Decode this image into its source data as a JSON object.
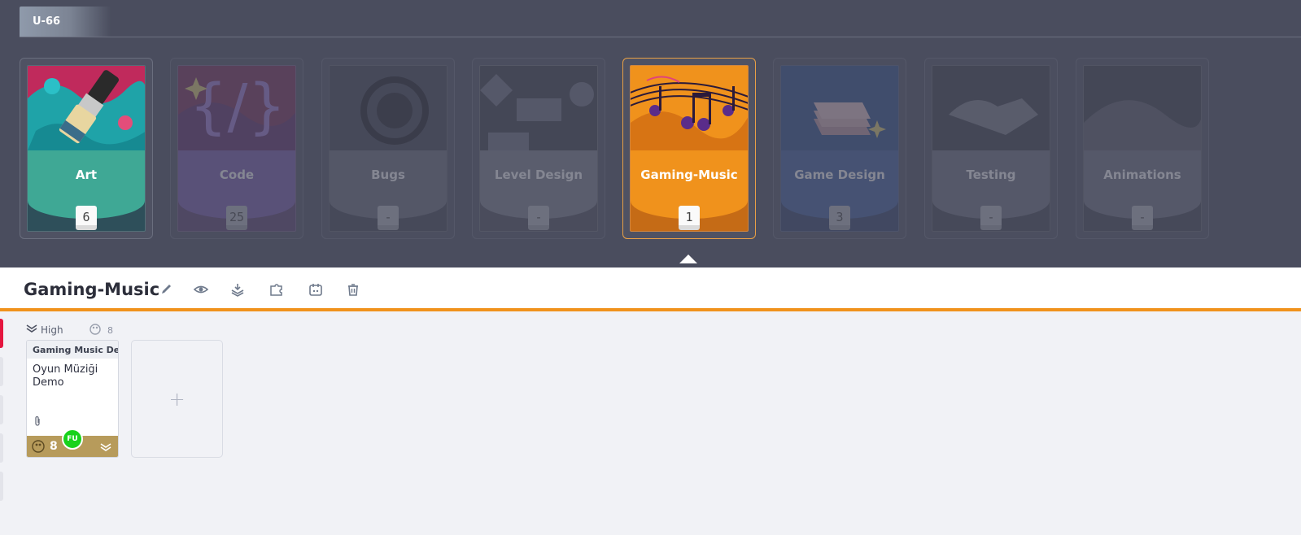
{
  "project": {
    "label": "U-66"
  },
  "categories": [
    {
      "title": "Art",
      "count": "6",
      "color": "#3fa895",
      "title_color": "#ffffff",
      "state": "normal"
    },
    {
      "title": "Code",
      "count": "25",
      "color": "#7b5bb0",
      "title_color": "#ffffff",
      "state": "dim"
    },
    {
      "title": "Bugs",
      "count": "-",
      "color": "#6a6d7c",
      "title_color": "#ffffff",
      "state": "dim"
    },
    {
      "title": "Level Design",
      "count": "-",
      "color": "#7c7f8d",
      "title_color": "#ffffff",
      "state": "dim"
    },
    {
      "title": "Gaming-Music",
      "count": "1",
      "color": "#f0921c",
      "title_color": "#ffffff",
      "state": "active"
    },
    {
      "title": "Game Design",
      "count": "3",
      "color": "#3f5ea0",
      "title_color": "#ffffff",
      "state": "dim"
    },
    {
      "title": "Testing",
      "count": "-",
      "color": "#6e7180",
      "title_color": "#ffffff",
      "state": "dim"
    },
    {
      "title": "Animations",
      "count": "-",
      "color": "#6e7180",
      "title_color": "#ffffff",
      "state": "dim"
    }
  ],
  "header": {
    "title": "Gaming-Music",
    "icons": [
      "pencil-icon",
      "eye-icon",
      "archive-download-icon",
      "puzzle-icon",
      "calendar-icon",
      "trash-icon"
    ],
    "accent": "#f0921c"
  },
  "board": {
    "lane": {
      "label": "High",
      "count": "8"
    },
    "tasks": [
      {
        "title": "Gaming Music Demo",
        "description": "Oyun Müziği Demo",
        "points": "8",
        "assignee_initials": "FU",
        "footer_color": "#b79b5b"
      }
    ],
    "add_symbol": "+"
  }
}
